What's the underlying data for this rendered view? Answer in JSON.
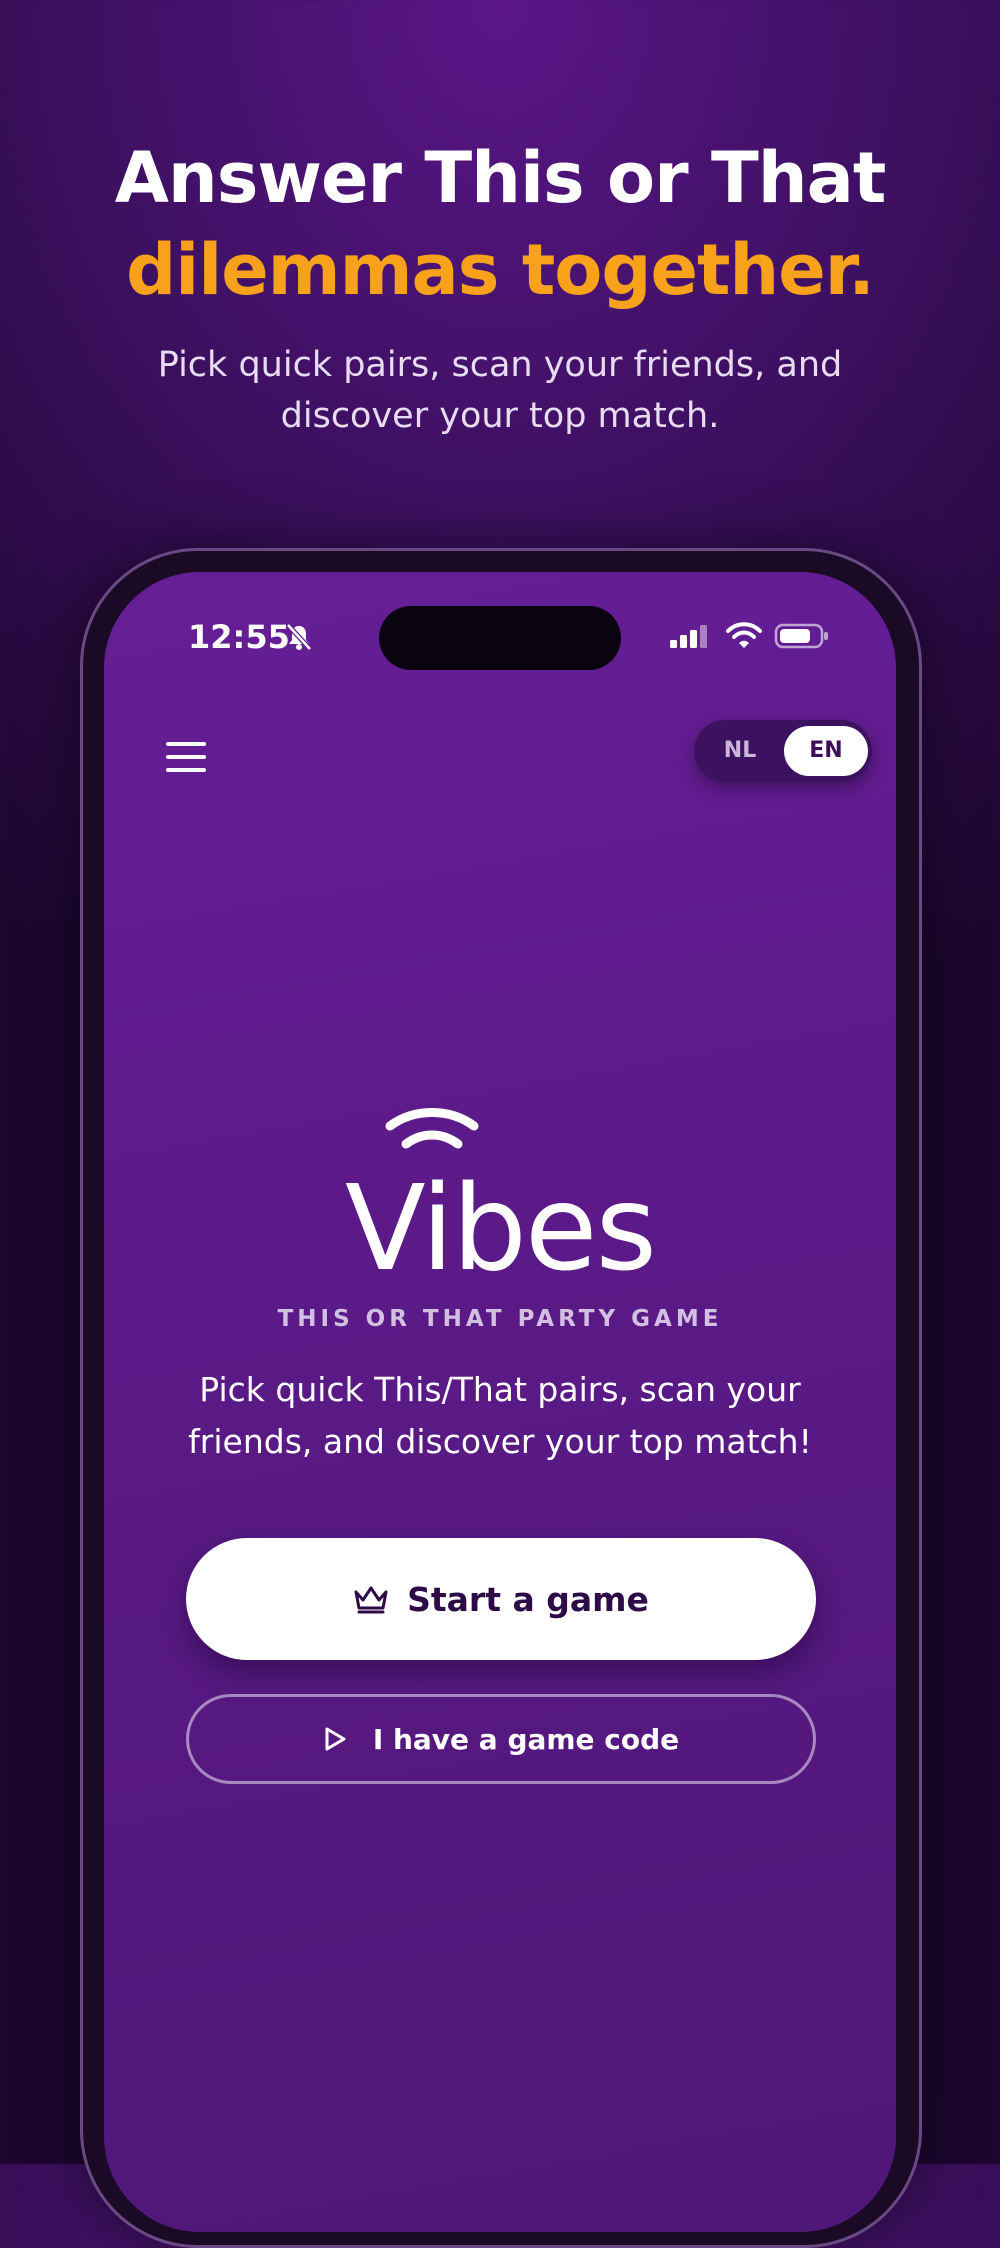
{
  "hero": {
    "title_line1": "Answer This or That",
    "title_line2": "dilemmas together.",
    "subtitle": "Pick quick pairs, scan your friends, and discover your top match."
  },
  "status_bar": {
    "time": "12:55",
    "icons": [
      "bell-muted-icon",
      "cellular-signal-icon",
      "wifi-icon",
      "battery-icon"
    ]
  },
  "app_header": {
    "menu_icon": "hamburger-menu-icon",
    "languages": [
      "NL",
      "EN"
    ],
    "selected_language": "EN"
  },
  "brand": {
    "logo_text": "Vibes",
    "tagline": "THIS OR THAT PARTY GAME",
    "description": "Pick quick This/That pairs, scan your friends, and discover your top match!"
  },
  "actions": {
    "start_label": "Start a game",
    "start_icon": "crown-icon",
    "code_label": "I have a game code",
    "code_icon": "play-icon"
  },
  "colors": {
    "accent_orange": "#f7a21a",
    "background_purple": "#3e1062",
    "screen_purple": "#5b1a88",
    "button_text": "#2c0b46"
  }
}
